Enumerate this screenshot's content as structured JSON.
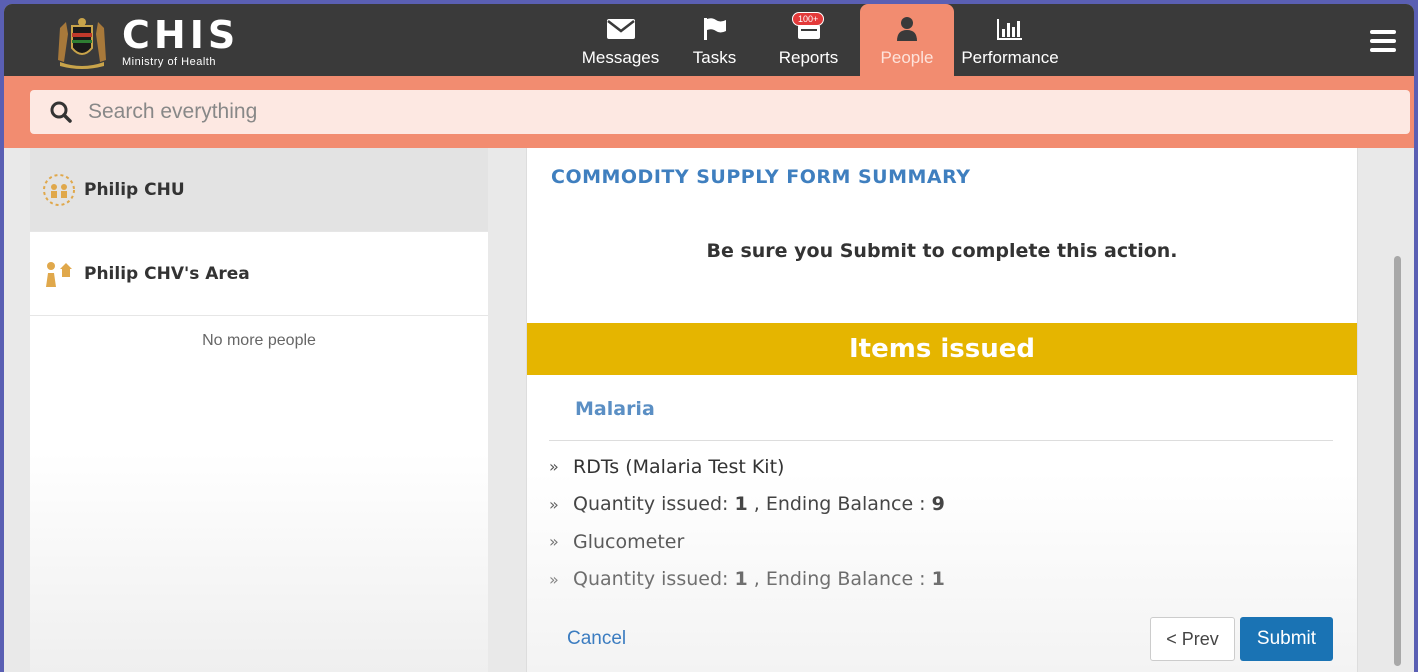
{
  "app": {
    "title": "CHIS",
    "subtitle": "Ministry of Health"
  },
  "nav": {
    "tabs": [
      {
        "label": "Messages",
        "icon": "envelope-icon"
      },
      {
        "label": "Tasks",
        "icon": "flag-icon"
      },
      {
        "label": "Reports",
        "icon": "reports-icon",
        "badge": "100+"
      },
      {
        "label": "People",
        "icon": "person-icon",
        "active": true
      },
      {
        "label": "Performance",
        "icon": "bar-chart-icon"
      }
    ]
  },
  "search": {
    "placeholder": "Search everything"
  },
  "sidebar": {
    "items": [
      {
        "label": "Philip CHU",
        "icon": "chu-icon",
        "selected": true
      },
      {
        "label": "Philip CHV's Area",
        "icon": "family-icon",
        "selected": false
      }
    ],
    "empty_text": "No more people"
  },
  "form": {
    "title": "COMMODITY SUPPLY FORM SUMMARY",
    "notice": "Be sure you Submit to complete this action.",
    "band_title": "Items issued",
    "group_title": "Malaria",
    "items": [
      {
        "text": "RDTs (Malaria Test Kit)"
      },
      {
        "prefix": "Quantity issued: ",
        "qty": "1",
        "mid": " , Ending Balance : ",
        "bal": "9"
      },
      {
        "text": "Glucometer"
      },
      {
        "prefix": "Quantity issued: ",
        "qty": "1",
        "mid": " , Ending Balance : ",
        "bal": "1"
      }
    ],
    "bullet": "»",
    "cancel_label": "Cancel",
    "prev_label": "< Prev",
    "submit_label": "Submit"
  },
  "colors": {
    "topbar": "#3a3a3a",
    "accent": "#f28c70",
    "band": "#e5b500",
    "link": "#3b7cc0",
    "submit": "#1a73b4"
  }
}
